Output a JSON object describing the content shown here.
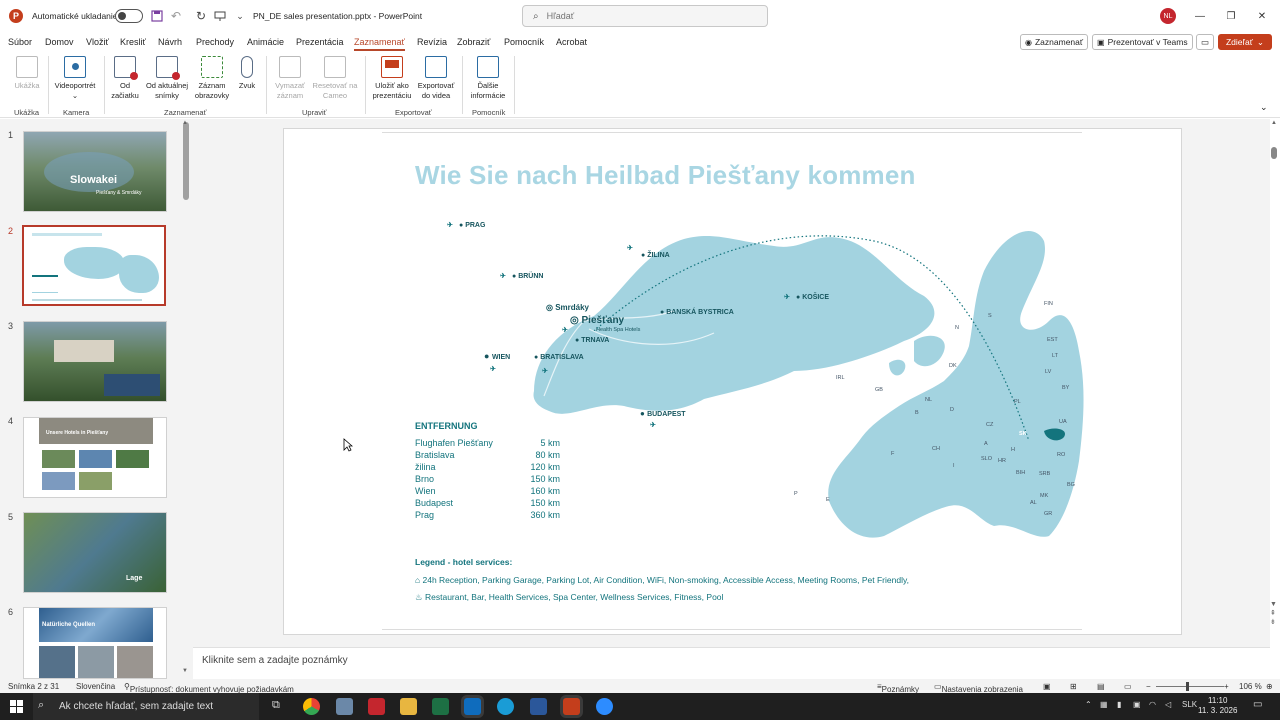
{
  "titlebar": {
    "autosave_label": "Automatické ukladanie",
    "document_title": "PN_DE sales presentation.pptx  -  PowerPoint",
    "search_placeholder": "Hľadať",
    "user_initials": "NL"
  },
  "menu": {
    "tabs": [
      "Súbor",
      "Domov",
      "Vložiť",
      "Kresliť",
      "Návrh",
      "Prechody",
      "Animácie",
      "Prezentácia",
      "Zaznamenať",
      "Revízia",
      "Zobraziť",
      "Pomocník",
      "Acrobat"
    ],
    "active_tab": "Zaznamenať",
    "record_button": "Zaznamenať",
    "teams_button": "Prezentovať v Teams",
    "share_button": "Zdieľať"
  },
  "ribbon": {
    "buttons": [
      {
        "label": "Ukážka",
        "enabled": false
      },
      {
        "label": "Videoportrét",
        "enabled": true
      },
      {
        "label": "Od začiatku",
        "enabled": true
      },
      {
        "label": "Od aktuálnej snímky",
        "enabled": true
      },
      {
        "label": "Záznam obrazovky",
        "enabled": true
      },
      {
        "label": "Zvuk",
        "enabled": true
      },
      {
        "label": "Vymazať záznam",
        "enabled": false
      },
      {
        "label": "Resetovať na Cameo",
        "enabled": false
      },
      {
        "label": "Uložiť ako prezentáciu",
        "enabled": true
      },
      {
        "label": "Exportovať do videa",
        "enabled": true
      },
      {
        "label": "Ďalšie informácie",
        "enabled": true
      }
    ],
    "groups": [
      "Ukážka",
      "Kamera",
      "Zaznamenať",
      "Upraviť",
      "Exportovať",
      "Pomocník"
    ]
  },
  "thumbnails": {
    "numbers": [
      "1",
      "2",
      "3",
      "4",
      "5",
      "6"
    ],
    "active_index": 2,
    "slide1_title": "Slowakei",
    "slide1_subtitle": "Piešťany & Smrdáky",
    "slide4_title": "Unsere Hotels in Piešťany",
    "slide5_caption": "Lage",
    "slide6_title": "Natürliche Quellen"
  },
  "slide": {
    "title": "Wie Sie nach Heilbad Piešťany kommen",
    "places": [
      "PRAG",
      "BRÜNN",
      "WIEN",
      "BRATISLAVA",
      "TRNAVA",
      "Smrdáky",
      "Piešťany",
      "Health Spa Hotels",
      "ŽILINA",
      "BANSKÁ BYSTRICA",
      "KOŠICE",
      "BUDAPEST"
    ],
    "country_codes": [
      "FIN",
      "S",
      "N",
      "EST",
      "LT",
      "LV",
      "BY",
      "IRL",
      "GB",
      "DK",
      "NL",
      "B",
      "D",
      "PL",
      "UA",
      "F",
      "CH",
      "CZ",
      "A",
      "H",
      "RO",
      "SLO",
      "HR",
      "BIH",
      "SRB",
      "I",
      "AL",
      "MK",
      "BG",
      "GR",
      "E",
      "P",
      "SK"
    ],
    "distance_heading": "ENTFERNUNG",
    "distances": [
      {
        "place": "Flughafen Piešťany",
        "km": "5 km"
      },
      {
        "place": "Bratislava",
        "km": "80 km"
      },
      {
        "place": "žilina",
        "km": "120 km"
      },
      {
        "place": "Brno",
        "km": "150 km"
      },
      {
        "place": "Wien",
        "km": "160 km"
      },
      {
        "place": "Budapest",
        "km": "150 km"
      },
      {
        "place": "Prag",
        "km": "360 km"
      }
    ],
    "legend_title": "Legend - hotel services:",
    "legend_row1": "24h Reception,   Parking Garage,   Parking Lot,   Air Condition,   WiFi,   Non-smoking,   Accessible Access,   Meeting Rooms,   Pet Friendly,",
    "legend_row2": "Restaurant,   Bar,   Health Services,   Spa Center,   Wellness Services,   Fitness,   Pool"
  },
  "notes_placeholder": "Kliknite sem a zadajte poznámky",
  "status": {
    "slide_counter": "Snímka 2 z 31",
    "language": "Slovenčina",
    "accessibility": "Prístupnosť: dokument vyhovuje požiadavkám",
    "notes": "Poznámky",
    "display_settings": "Nastavenia zobrazenia",
    "zoom": "106 %"
  },
  "taskbar": {
    "search_placeholder": "Ak chcete hľadať, sem zadajte text",
    "language": "SLK",
    "time": "11:10",
    "date": "11. 3. 2026"
  },
  "colors": {
    "accent": "#b7472a",
    "teal": "#13747d",
    "map": "#a3d3e0",
    "title": "#a9d6e3"
  }
}
